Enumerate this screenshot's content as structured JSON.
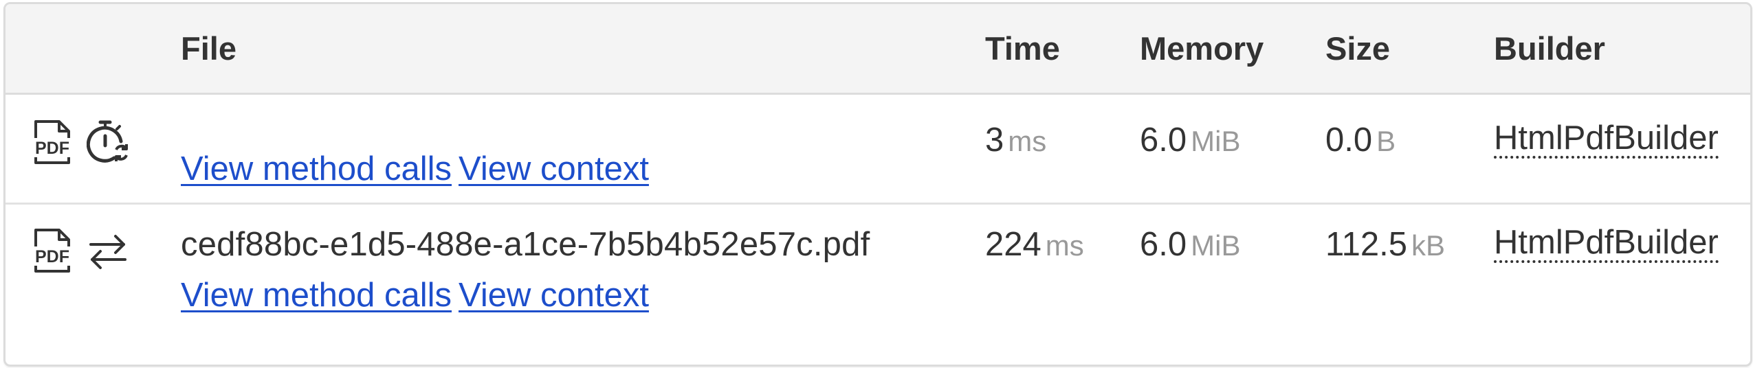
{
  "table": {
    "headers": {
      "icons": "",
      "file": "File",
      "time": "Time",
      "memory": "Memory",
      "size": "Size",
      "builder": "Builder"
    },
    "rows": [
      {
        "file_name": "",
        "link_method_calls": "View method calls",
        "link_context": "View context",
        "time_value": "3",
        "time_unit": "ms",
        "memory_value": "6.0",
        "memory_unit": "MiB",
        "size_value": "0.0",
        "size_unit": "B",
        "builder": "HtmlPdfBuilder",
        "icons": [
          "pdf-file-icon",
          "stopwatch-refresh-icon"
        ]
      },
      {
        "file_name": "cedf88bc-e1d5-488e-a1ce-7b5b4b52e57c.pdf",
        "link_method_calls": "View method calls",
        "link_context": "View context",
        "time_value": "224",
        "time_unit": "ms",
        "memory_value": "6.0",
        "memory_unit": "MiB",
        "size_value": "112.5",
        "size_unit": "kB",
        "builder": "HtmlPdfBuilder",
        "icons": [
          "pdf-file-icon",
          "transfer-arrows-icon"
        ]
      }
    ]
  },
  "pdf_badge_text": "PDF",
  "colors": {
    "link": "#1d4ecb",
    "header_bg": "#f4f4f4",
    "border": "#dcdcdc",
    "unit_text": "#999999"
  }
}
